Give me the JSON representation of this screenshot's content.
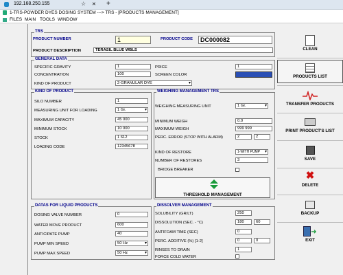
{
  "browser": {
    "url": "192.168.250.155",
    "star": "☆",
    "close": "✕",
    "new_tab": "+"
  },
  "window_title": "1-TRS-POWDER DYES DOSING SYSTEM ---> TRS - [PRODUCTS MANAGEMENT]",
  "menu": [
    "FILES",
    "MAIN",
    "TOOLS",
    "WINDOW"
  ],
  "trs": {
    "legend": "TRS",
    "product_number_label": "PRODUCT NUMBER",
    "product_number": "1",
    "product_code_label": "PRODUCT CODE",
    "product_code": "DC000082",
    "product_description_label": "PRODUCT DESCRIPTION",
    "product_description": "TERASIL BLUE WBLS"
  },
  "general": {
    "legend": "GENERAL DATA",
    "specific_gravity_label": "SPECIFIC GRAVITY",
    "specific_gravity": "1",
    "concentration_label": "CONCENTRATION",
    "concentration": "100",
    "kind_label": "KIND OF PRODUCT",
    "kind": "2-GRANULAR DYE",
    "price_label": "PRICE",
    "price": "1",
    "screen_color_label": "SCREEN COLOR",
    "screen_color": "#2a4fb5"
  },
  "kind_product": {
    "legend": "KIND OF PRODUCT",
    "silo_label": "SILO NUMBER",
    "silo": "1",
    "unit_label": "MEASURING UNIT FOR LOADING",
    "unit": "1 Gr.",
    "max_cap_label": "MAXIMUM CAPACITY",
    "max_cap": "45 000",
    "min_stock_label": "MINIMUM STOCK",
    "min_stock": "10 000",
    "stock_label": "STOCK",
    "stock": "1 612",
    "loading_code_label": "LOADING CODE",
    "loading_code": "12345678"
  },
  "weighing": {
    "legend": "WEIGHING MANAGEMENT TRS",
    "unit_label": "WEIGHING MEASURING UNIT",
    "unit": "1 Gr.",
    "min_label": "MINIMUM WEIGH",
    "min": "0.0",
    "max_label": "MAXIMUM WEIGH",
    "max": "999 999",
    "perc_label": "PERC. ERROR (STOP WITH ALARM)",
    "perc_a": "2",
    "perc_b": "2",
    "restore_label": "KIND OF RESTORE",
    "restore": "1-WITH PUMP",
    "num_restores_label": "NUMBER OF RESTORES",
    "num_restores": "3",
    "bridge_label": "BRIDGE BREAKER",
    "threshold_label": "THRESHOLD MANAGEMENT"
  },
  "liquid": {
    "legend": "DATAS FOR LIQUID PRODUCTS",
    "valve_label": "DOSING VALVE NUMBER",
    "valve": "0",
    "water_label": "WATER MOVE PRODUCT",
    "water": "600",
    "anticipate_label": "ANTICIPATE PUMP",
    "anticipate": "40",
    "min_speed_label": "PUMP MIN SPEED",
    "min_speed": "50 Hz",
    "max_speed_label": "PUMP MAX SPEED",
    "max_speed": "50 Hz"
  },
  "dissolver": {
    "legend": "DISSOLVER MANAGEMENT",
    "solubility_label": "SOLUBILITY (GR/LT)",
    "solubility": "250",
    "dissolution_label": "DISSOLUTION (SEC. - °C)",
    "dissolution_sec": "180",
    "dissolution_c": "60",
    "antifoam_label": "ANTIFOAM TIME (SEC)",
    "antifoam": "0",
    "additive_label": "PERC. ADDITIVE (%) [1-2]",
    "additive_a": "0",
    "additive_b": "0",
    "rinses_label": "RINSES TO DRAIN",
    "rinses": "1",
    "force_label": "FORCE COLD WATER"
  },
  "side": {
    "clean": "CLEAN",
    "products_list": "PRODUCTS LIST",
    "transfer": "TRANSFER PRODUCTS",
    "print": "PRINT PRODUCT'S LIST",
    "save": "SAVE",
    "delete": "DELETE",
    "backup": "BACKUP",
    "exit": "EXIT"
  }
}
